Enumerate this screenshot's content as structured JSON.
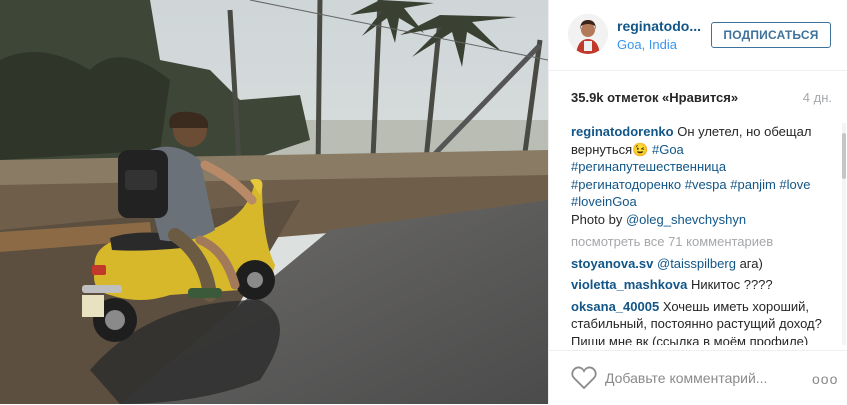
{
  "post": {
    "username": "reginatodo...",
    "location": "Goa, India",
    "follow_label": "ПОДПИСАТЬСЯ",
    "likes": "35.9k отметок «Нравится»",
    "time": "4 дн."
  },
  "caption": {
    "user": "reginatodorenko",
    "text": "Он улетел, но обещал вернуться",
    "emoji": "😉",
    "tags": [
      "#Goa",
      "#регинапутешественница",
      "#регинатодоренко",
      "#vespa",
      "#panjim",
      "#love",
      "#loveinGoa"
    ],
    "photo_by_label": "Photo by",
    "photo_by_user": "@oleg_shevchyshyn"
  },
  "load_more": "посмотреть все 71 комментариев",
  "comments": [
    {
      "user": "stoyanova.sv",
      "mention": "@taisspilberg",
      "text": "ага)"
    },
    {
      "user": "violetta_mashkova",
      "text": "Никитос ????"
    },
    {
      "user": "oksana_40005",
      "text": "Хочешь иметь хороший, стабильный, постоянно растущий доход? Пиши мне вк (ссылка в моём профиле) Обучение"
    }
  ],
  "footer": {
    "add_comment_placeholder": "Добавьте комментарий...",
    "heart_icon": "heart-outline-icon",
    "more_icon": "more-options-icon",
    "more_text": "ooo"
  },
  "colors": {
    "username": "#125688",
    "link": "#3897f0",
    "follow_border": "#3f729b",
    "muted": "#a5a7aa"
  }
}
